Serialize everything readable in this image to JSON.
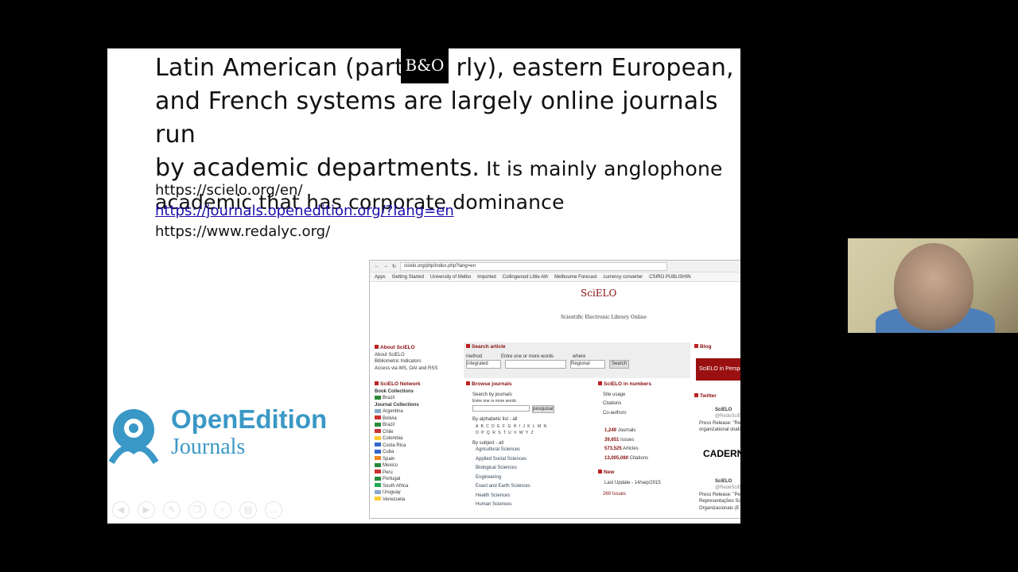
{
  "slide": {
    "heading_line1": "Latin American (partic",
    "heading_line1_rest": "rly), eastern European,",
    "heading_line2": "and French systems are largely online journals run",
    "heading_line3a": "by academic departments.",
    "heading_line3b": " It is mainly anglophone",
    "heading_line4": "academic that has corporate dominance",
    "urls": [
      "https://scielo.org/en/",
      "https://journals.openedition.org/?lang=en",
      "https://www.redalyc.org/"
    ],
    "bo_logo": "B&O",
    "openedition_title": "OpenEdition",
    "openedition_sub": "Journals"
  },
  "embedded": {
    "address": "scielo.org/php/index.php?lang=en",
    "bookmarks": [
      "Apps",
      "Getting Started",
      "University of Melbo",
      "Imported",
      "Collingwood Little Ath",
      "Melbourne Forecast",
      "currency converter",
      "CSIRO PUBLISHIN"
    ],
    "logo": "SciELO",
    "tagline": "Scientific Electronic Library Online",
    "about_hd": "About SciELO",
    "about_items": [
      "About SciELO",
      "Bibliometric Indicators",
      "Access via WS, OAI and RSS"
    ],
    "search_hd": "Search article",
    "search_labels": [
      "method",
      "Entre one or more words",
      "where"
    ],
    "search_method": "integrated",
    "search_where": "Regional",
    "search_btn": "Search",
    "blog_hd": "Blog",
    "blog_img": "SciELO in Perspe",
    "network_hd": "SciELO Network",
    "book_collections": "Book Collections",
    "brazil_book": "Brazil",
    "journal_collections": "Journal Collections",
    "countries": [
      "Argentina",
      "Bolivia",
      "Brazil",
      "Chile",
      "Colombia",
      "Costa Rica",
      "Cuba",
      "Spain",
      "Mexico",
      "Peru",
      "Portugal",
      "South Africa",
      "Uruguay",
      "Venezuela"
    ],
    "browse_hd": "Browse journals",
    "search_by_journals": "Search by journals",
    "enter_words": "Entre one or more words",
    "pesquisar": "pesquisar",
    "by_alpha": "By alphabetic list - all",
    "alpha1": "A B C D E F G H I J K L M N",
    "alpha2": "O P Q R S T U V W Y Z",
    "by_subject": "By subject - all",
    "subjects": [
      "Agricultural Sciences",
      "Applied Social Sciences",
      "Biological Sciences",
      "Engineering",
      "Exact and Earth Sciences",
      "Health Sciences",
      "Human Sciences"
    ],
    "numbers_hd": "SciELO in numbers",
    "number_links": [
      "Site usage",
      "Citations",
      "Co-authors"
    ],
    "stats": [
      [
        "1,249",
        "Journals"
      ],
      [
        "39,651",
        "Issues"
      ],
      [
        "573,525",
        "Articles"
      ],
      [
        "13,005,080",
        "Citations"
      ]
    ],
    "new_hd": "New",
    "last_update": "Last Update - 14/sep/2015",
    "new_issues": "269 Issues",
    "twitter_hd": "Twitter",
    "tweet1_name": "SciELO",
    "tweet1_handle": "@RedeSciE",
    "tweet1_text1": "Press Release: \"Re",
    "tweet1_text2": "organizational studi",
    "caderno": "CADERN",
    "tweet2_name": "SciELO",
    "tweet2_handle": "@RedeSciE",
    "tweet2_text1": "Press Release: \"Pe",
    "tweet2_text2": "Representações So",
    "tweet2_text3": "Organizacionais (E"
  },
  "colors": {
    "link": "#1a0dab",
    "openedition": "#3a98c6",
    "scielo_red": "#8a0e0e",
    "background": "#000000"
  }
}
